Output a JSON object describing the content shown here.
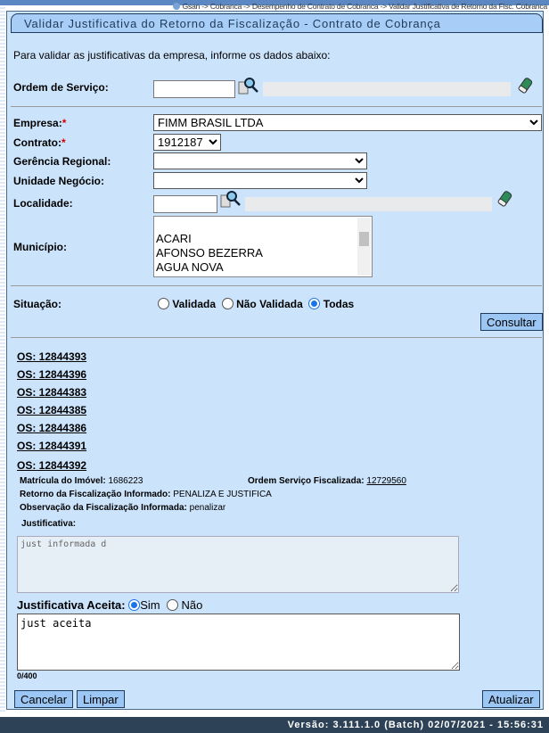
{
  "breadcrumb": "Gsan -> Cobranca -> Desempenho de Contrato de Cobranca -> Validar Justificativa de Retorno da Fisc. Cobranca",
  "title": "Validar Justificativa do Retorno da Fiscalização - Contrato de Cobrança",
  "intro": "Para validar as justificativas da empresa, informe os dados abaixo:",
  "form": {
    "ordem_servico_label": "Ordem de Serviço:",
    "ordem_servico_value": "",
    "empresa_label": "Empresa:",
    "empresa_value": "FIMM BRASIL LTDA",
    "contrato_label": "Contrato:",
    "contrato_value": "1912187",
    "gerencia_label": "Gerência Regional:",
    "gerencia_value": "",
    "unidade_label": "Unidade Negócio:",
    "unidade_value": "",
    "localidade_label": "Localidade:",
    "localidade_value": "",
    "municipio_label": "Município:",
    "municipios": [
      "ACARI",
      "AFONSO BEZERRA",
      "AGUA NOVA"
    ],
    "required_mark": "*",
    "situacao_label": "Situação:",
    "situacao_options": [
      "Validada",
      "Não Validada",
      "Todas"
    ],
    "situacao_selected": "Todas",
    "consultar": "Consultar"
  },
  "results": [
    "OS: 12844393",
    "OS: 12844396",
    "OS: 12844383",
    "OS: 12844385",
    "OS: 12844386",
    "OS: 12844391",
    "OS: 12844392"
  ],
  "detail": {
    "matricula_label": "Matrícula do Imóvel:",
    "matricula": "1686223",
    "os_fisc_label": "Ordem Serviço Fiscalizada:",
    "os_fisc": "12729560",
    "retorno_label": "Retorno da Fiscalização Informado:",
    "retorno": "PENALIZA E JUSTIFICA",
    "obs_label": "Observação da Fiscalização Informada:",
    "obs": "penalizar",
    "justificativa_label": "Justificativa:",
    "justificativa": "just informada d",
    "aceita_label": "Justificativa Aceita:",
    "aceita_options": [
      "Sim",
      "Não"
    ],
    "aceita_selected": "Sim",
    "aceita_text": "just aceita",
    "counter": "0/400"
  },
  "buttons": {
    "cancelar": "Cancelar",
    "limpar": "Limpar",
    "atualizar": "Atualizar"
  },
  "footer": "Versão: 3.111.1.0 (Batch) 02/07/2021 - 15:56:31"
}
